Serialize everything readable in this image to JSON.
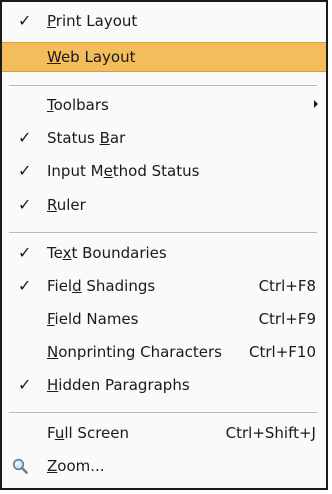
{
  "menu": {
    "print_layout": {
      "checked": "✓",
      "pre": "",
      "mn": "P",
      "post": "rint Layout"
    },
    "web_layout": {
      "checked": "",
      "pre": "",
      "mn": "W",
      "post": "eb Layout"
    },
    "toolbars": {
      "checked": "",
      "pre": "",
      "mn": "T",
      "post": "oolbars"
    },
    "status_bar": {
      "checked": "✓",
      "pre": "Status ",
      "mn": "B",
      "post": "ar"
    },
    "input_method_status": {
      "checked": "✓",
      "pre": "Input M",
      "mn": "e",
      "post": "thod Status"
    },
    "ruler": {
      "checked": "✓",
      "pre": "",
      "mn": "R",
      "post": "uler"
    },
    "text_boundaries": {
      "checked": "✓",
      "pre": "Te",
      "mn": "x",
      "post": "t Boundaries"
    },
    "field_shadings": {
      "checked": "✓",
      "pre": "Fiel",
      "mn": "d",
      "post": " Shadings",
      "accel": "Ctrl+F8"
    },
    "field_names": {
      "checked": "",
      "pre": "",
      "mn": "F",
      "post": "ield Names",
      "accel": "Ctrl+F9"
    },
    "nonprinting_characters": {
      "checked": "",
      "pre": "",
      "mn": "N",
      "post": "onprinting Characters",
      "accel": "Ctrl+F10"
    },
    "hidden_paragraphs": {
      "checked": "✓",
      "pre": "",
      "mn": "H",
      "post": "idden Paragraphs"
    },
    "full_screen": {
      "checked": "",
      "pre": "F",
      "mn": "u",
      "post": "ll Screen",
      "accel": "Ctrl+Shift+J"
    },
    "zoom": {
      "icon": "zoom-magnifier-icon",
      "pre": "",
      "mn": "Z",
      "post": "oom..."
    }
  },
  "colors": {
    "highlight": "#f3bd5b",
    "background": "#fafafa",
    "separator": "#b9b9b9"
  }
}
